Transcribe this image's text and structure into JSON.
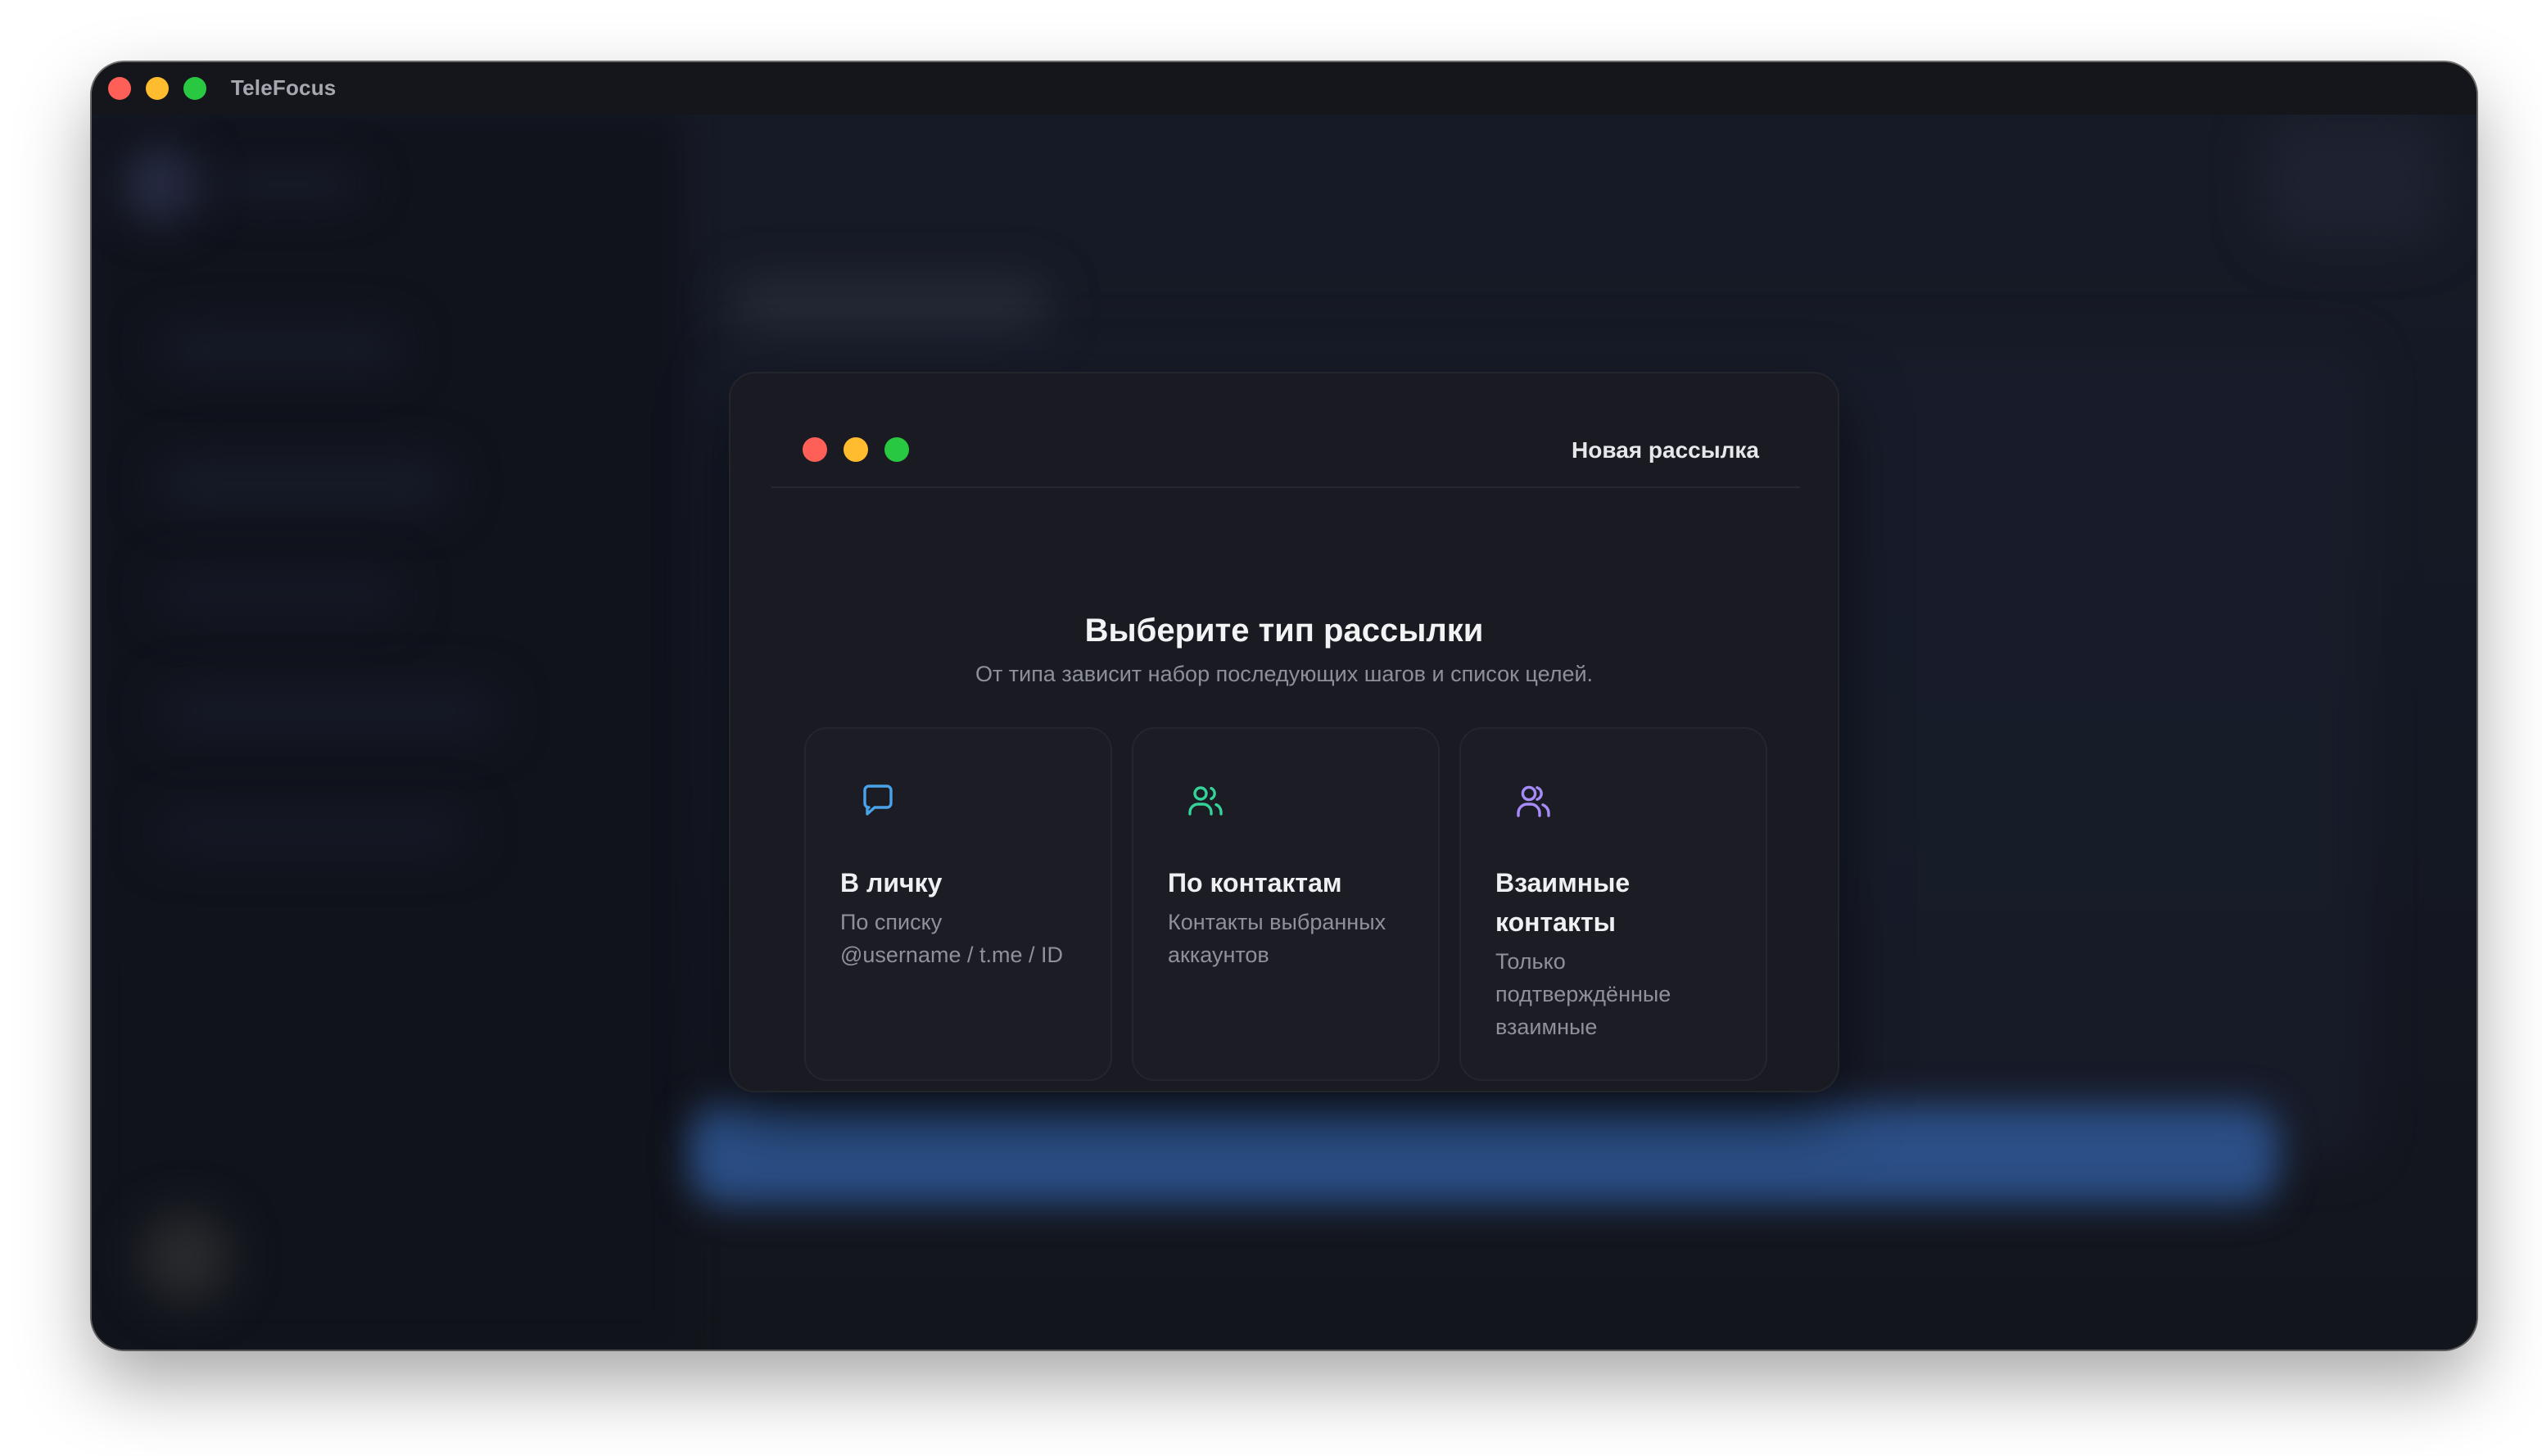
{
  "app": {
    "title": "TeleFocus"
  },
  "modal": {
    "title": "Новая рассылка",
    "heading": "Выберите тип рассылки",
    "subheading": "От типа зависит набор последующих шагов и список целей."
  },
  "cards": [
    {
      "icon": "message-bubble-icon",
      "icon_color": "#4aa3e8",
      "title_lines": [
        "В личку"
      ],
      "desc_lines": [
        "По списку",
        "@username / t.me / ID"
      ]
    },
    {
      "icon": "users-icon",
      "icon_color": "#34d399",
      "title_lines": [
        "По контактам"
      ],
      "desc_lines": [
        "Контакты выбранных",
        "аккаунтов"
      ]
    },
    {
      "icon": "users-mutual-icon",
      "icon_color": "#a78bfa",
      "title_lines": [
        "Взаимные",
        "контакты"
      ],
      "desc_lines": [
        "Только",
        "подтверждённые",
        "взаимные"
      ]
    }
  ],
  "colors": {
    "traffic_red": "#fe5f57",
    "traffic_yellow": "#febc2e",
    "traffic_green": "#28c840",
    "window_bg": "#13151c",
    "modal_bg": "#1a1b22"
  }
}
